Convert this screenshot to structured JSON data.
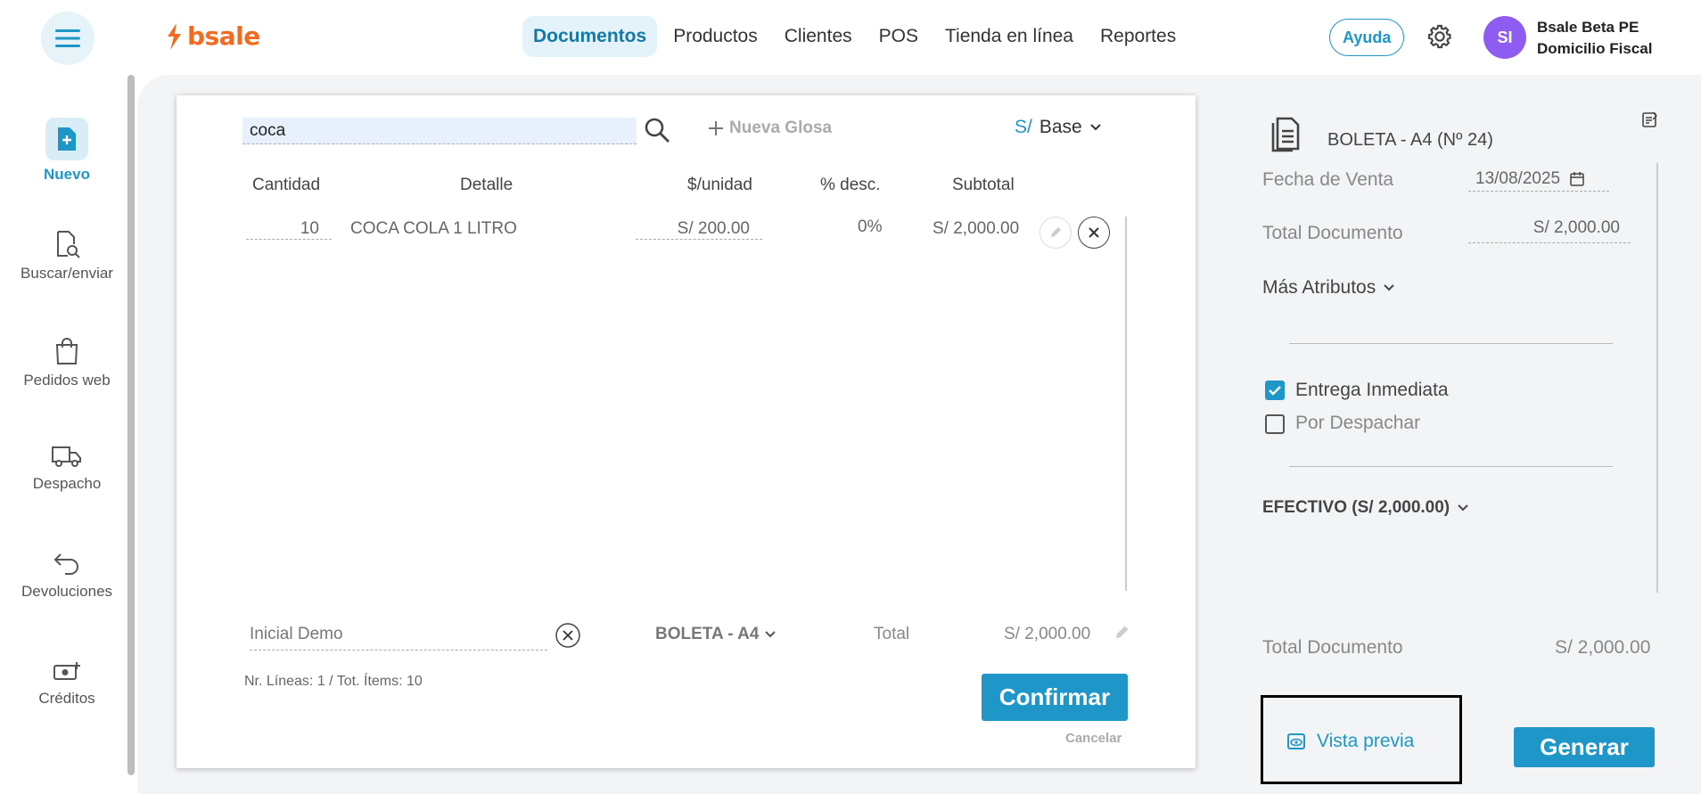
{
  "header": {
    "logo_text": "bsale",
    "nav": [
      "Documentos",
      "Productos",
      "Clientes",
      "POS",
      "Tienda en línea",
      "Reportes"
    ],
    "help_label": "Ayuda",
    "avatar_initials": "SI",
    "account_name": "Bsale Beta PE",
    "account_branch": "Domicilio Fiscal"
  },
  "sidebar": {
    "items": [
      {
        "label": "Nuevo",
        "icon": "new-document-icon"
      },
      {
        "label": "Buscar/enviar",
        "icon": "document-search-icon"
      },
      {
        "label": "Pedidos web",
        "icon": "shopping-bag-icon"
      },
      {
        "label": "Despacho",
        "icon": "truck-icon"
      },
      {
        "label": "Devoluciones",
        "icon": "return-arrow-icon"
      },
      {
        "label": "Créditos",
        "icon": "cash-plus-icon"
      }
    ]
  },
  "editor": {
    "search_value": "coca",
    "nueva_glosa": "Nueva Glosa",
    "currency_symbol": "S/",
    "price_list": "Base",
    "columns": [
      "Cantidad",
      "Detalle",
      "$/unidad",
      "% desc.",
      "Subtotal"
    ],
    "rows": [
      {
        "cantidad": "10",
        "detalle": "COCA COLA 1 LITRO",
        "unidad": "S/ 200.00",
        "desc": "0%",
        "subtotal": "S/ 2,000.00"
      }
    ],
    "client": "Inicial Demo",
    "doc_type": "BOLETA - A4",
    "total_label": "Total",
    "total_value": "S/ 2,000.00",
    "counts": "Nr. Líneas: 1 / Tot. Ítems: 10",
    "confirm_label": "Confirmar",
    "cancel_label": "Cancelar"
  },
  "summary": {
    "doc_title": "BOLETA - A4 (Nº 24)",
    "fecha_label": "Fecha de Venta",
    "fecha_value": "13/08/2025",
    "total_doc_label": "Total Documento",
    "total_doc_value": "S/ 2,000.00",
    "more_attrs": "Más Atributos",
    "entrega_inmediata": "Entrega Inmediata",
    "por_despachar": "Por Despachar",
    "payment": "EFECTIVO (S/ 2,000.00)",
    "total_bottom_label": "Total Documento",
    "total_bottom_value": "S/ 2,000.00",
    "preview_label": "Vista previa",
    "generate_label": "Generar"
  },
  "colors": {
    "accent": "#1e96c8",
    "brand": "#f26b21",
    "avatar": "#8e5cf0"
  }
}
